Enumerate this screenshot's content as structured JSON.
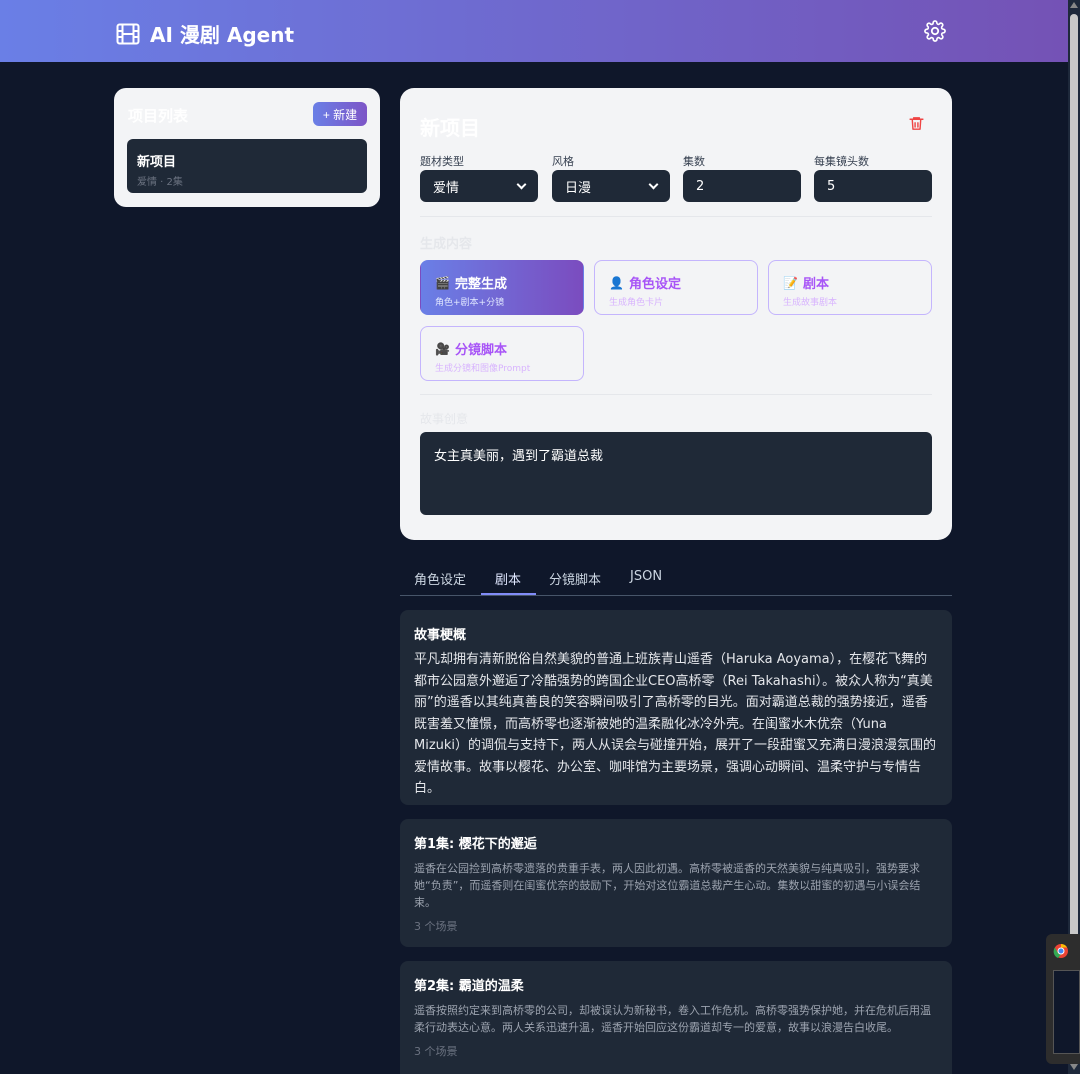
{
  "header": {
    "title": "AI 漫剧 Agent",
    "logo_icon": "film-icon",
    "settings_icon": "gear-icon"
  },
  "sidebar": {
    "title": "项目列表",
    "new_label": "+ 新建",
    "projects": [
      {
        "name": "新项目",
        "meta": "爱情 · 2集"
      }
    ]
  },
  "form": {
    "title": "新项目",
    "genre": {
      "label": "题材类型",
      "value": "爱情"
    },
    "style": {
      "label": "风格",
      "value": "日漫"
    },
    "episodes": {
      "label": "集数",
      "value": "2"
    },
    "shots": {
      "label": "每集镜头数",
      "value": "5"
    },
    "gen_section_label": "生成内容",
    "gen_options": [
      {
        "title": "完整生成",
        "sub": "角色+剧本+分镜",
        "icon": "🎬"
      },
      {
        "title": "角色设定",
        "sub": "生成角色卡片",
        "icon": "👤"
      },
      {
        "title": "剧本",
        "sub": "生成故事剧本",
        "icon": "📝"
      },
      {
        "title": "分镜脚本",
        "sub": "生成分镜和图像Prompt",
        "icon": "🎥"
      }
    ],
    "story_label": "故事创意",
    "story_value": "女主真美丽，遇到了霸道总裁"
  },
  "tabs": [
    "角色设定",
    "剧本",
    "分镜脚本",
    "JSON"
  ],
  "synopsis": {
    "title": "故事梗概",
    "text": "平凡却拥有清新脱俗自然美貌的普通上班族青山遥香（Haruka Aoyama），在樱花飞舞的都市公园意外邂逅了冷酷强势的跨国企业CEO高桥零（Rei Takahashi）。被众人称为“真美丽”的遥香以其纯真善良的笑容瞬间吸引了高桥零的目光。面对霸道总裁的强势接近，遥香既害羞又憧憬，而高桥零也逐渐被她的温柔融化冰冷外壳。在闺蜜水木优奈（Yuna Mizuki）的调侃与支持下，两人从误会与碰撞开始，展开了一段甜蜜又充满日漫浪漫氛围的爱情故事。故事以樱花、办公室、咖啡馆为主要场景，强调心动瞬间、温柔守护与专情告白。"
  },
  "episodes": [
    {
      "title": "第1集: 樱花下的邂逅",
      "text": "遥香在公园捡到高桥零遗落的贵重手表，两人因此初遇。高桥零被遥香的天然美貌与纯真吸引，强势要求她“负责”，而遥香则在闺蜜优奈的鼓励下，开始对这位霸道总裁产生心动。集数以甜蜜的初遇与小误会结束。",
      "scenes": "3 个场景"
    },
    {
      "title": "第2集: 霸道的温柔",
      "text": "遥香按照约定来到高桥零的公司，却被误认为新秘书，卷入工作危机。高桥零强势保护她，并在危机后用温柔行动表达心意。两人关系迅速升温，遥香开始回应这份霸道却专一的爱意，故事以浪漫告白收尾。",
      "scenes": "3 个场景"
    }
  ]
}
